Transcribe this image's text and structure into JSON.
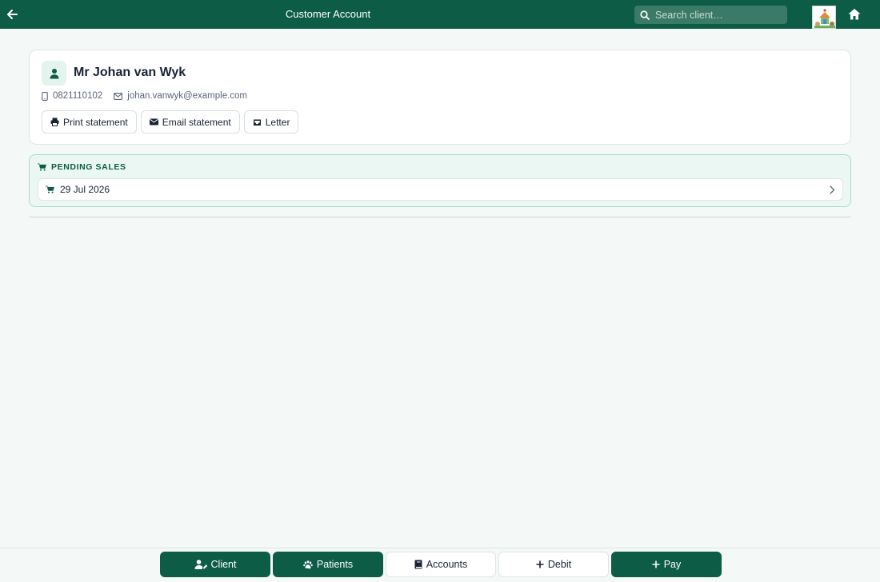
{
  "header": {
    "title": "Customer Account",
    "search_placeholder": "Search client…"
  },
  "client": {
    "name": "Mr Johan van Wyk",
    "phone": "0821110102",
    "email": "johan.vanwyk@example.com"
  },
  "actions": {
    "print_label": "Print statement",
    "email_label": "Email statement",
    "letter_label": "Letter"
  },
  "pending_sales": {
    "heading": "PENDING SALES",
    "items": [
      {
        "date": "29 Jul 2026"
      }
    ]
  },
  "bottom_nav": {
    "client": "Client",
    "patients": "Patients",
    "accounts": "Accounts",
    "debit": "Debit",
    "pay": "Pay"
  },
  "colors": {
    "brand": "#0d5c45",
    "pending_bg": "#eaf7f2"
  },
  "icons": [
    "back-arrow-icon",
    "search-icon",
    "home-icon",
    "user-icon",
    "phone-icon",
    "mail-icon",
    "printer-icon",
    "envelope-icon",
    "inbox-icon",
    "cart-icon",
    "chevron-right-icon",
    "user-edit-icon",
    "paw-icon",
    "book-icon",
    "plus-icon"
  ]
}
